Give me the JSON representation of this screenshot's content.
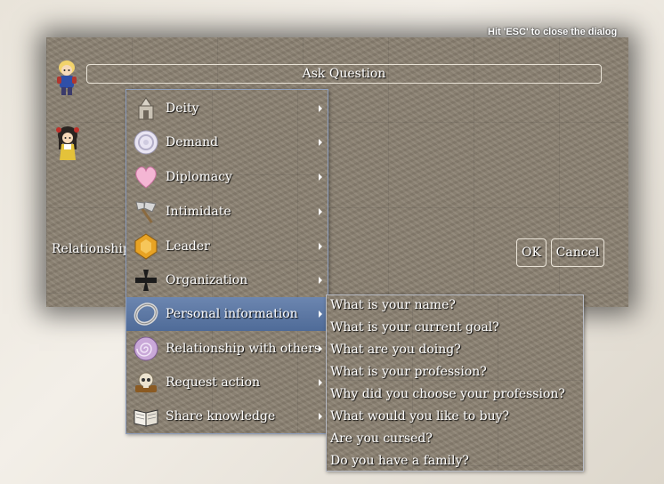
{
  "dialog": {
    "esc_hint": "Hit 'ESC' to close the dialog",
    "ask_question": "Ask Question",
    "relationship_label": "Relationship",
    "ok_label": "OK",
    "cancel_label": "Cancel"
  },
  "menu": {
    "items": [
      {
        "label": "Deity",
        "icon": "shrine-icon"
      },
      {
        "label": "Demand",
        "icon": "swirl-orb-icon"
      },
      {
        "label": "Diplomacy",
        "icon": "heart-icon"
      },
      {
        "label": "Intimidate",
        "icon": "axe-icon"
      },
      {
        "label": "Leader",
        "icon": "amber-gem-icon"
      },
      {
        "label": "Organization",
        "icon": "iron-cross-icon"
      },
      {
        "label": "Personal information",
        "icon": "ring-icon",
        "selected": true
      },
      {
        "label": "Relationship with others",
        "icon": "spiral-icon"
      },
      {
        "label": "Request action",
        "icon": "skull-icon"
      },
      {
        "label": "Share knowledge",
        "icon": "book-icon"
      }
    ]
  },
  "submenu": {
    "items": [
      "What is your name?",
      "What is your current goal?",
      "What are you doing?",
      "What is your profession?",
      "Why did you choose your profession?",
      "What would you like to buy?",
      "Are you cursed?",
      "Do you have a family?"
    ]
  },
  "colors": {
    "stone": "#8b8172",
    "selected": "#5a76a4",
    "text": "#ffffff"
  }
}
